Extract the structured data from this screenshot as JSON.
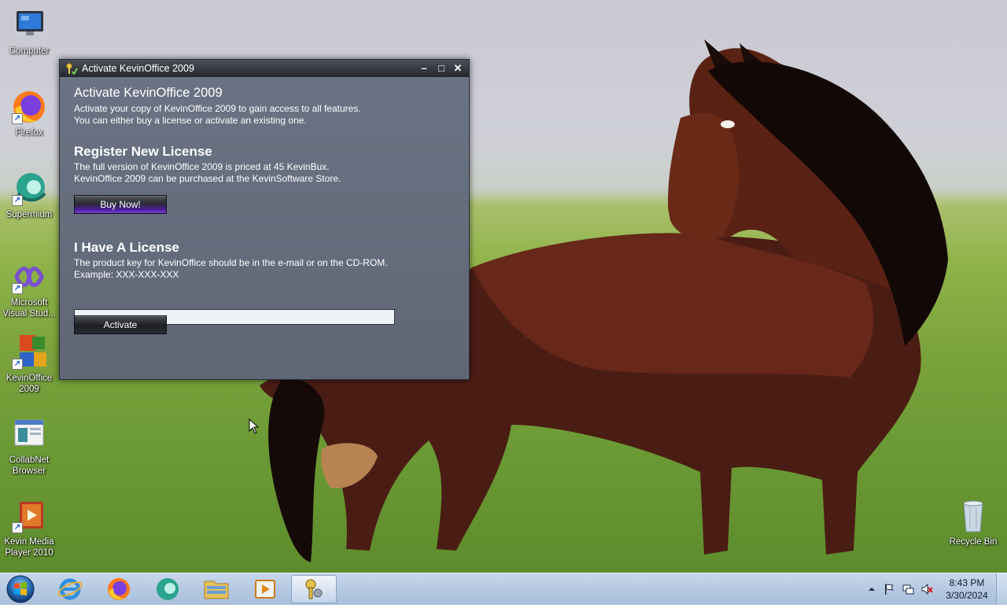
{
  "desktop": {
    "icons": [
      {
        "label": "Computer",
        "icon": "computer-icon",
        "shortcut": false
      },
      {
        "label": "Firefox",
        "icon": "firefox-icon",
        "shortcut": true
      },
      {
        "label": "Supermium",
        "icon": "supermium-icon",
        "shortcut": true
      },
      {
        "label": "Microsoft Visual Stud...",
        "icon": "visual-studio-icon",
        "shortcut": true
      },
      {
        "label": "KevinOffice 2009",
        "icon": "kevinoffice-icon",
        "shortcut": true
      },
      {
        "label": "CollabNet Browser",
        "icon": "collabnet-browser-icon",
        "shortcut": false
      },
      {
        "label": "Kevin Media Player 2010",
        "icon": "kevin-media-player-icon",
        "shortcut": true
      },
      {
        "label": "Recycle Bin",
        "icon": "recycle-bin-icon",
        "shortcut": false
      }
    ]
  },
  "dialog": {
    "title": "Activate KevinOffice 2009",
    "heading": "Activate KevinOffice 2009",
    "intro_line1": "Activate your copy of KevinOffice 2009 to gain access to all features.",
    "intro_line2": "You can either buy a license or activate an existing one.",
    "register": {
      "heading": "Register New License",
      "line1": "The full version of KevinOffice 2009 is priced at 45 KevinBux.",
      "line2": "KevinOffice 2009 can be purchased at the KevinSoftware Store.",
      "button_label": "Buy Now!"
    },
    "license": {
      "heading": "I Have A License",
      "line1": "The product key for KevinOffice should be in the e-mail or on the CD-ROM.",
      "line2": "Example: XXX-XXX-XXX",
      "input_value": "",
      "button_label": "Activate"
    },
    "controls": {
      "minimize": "minimize-icon",
      "maximize": "maximize-icon",
      "close": "close-icon"
    }
  },
  "taskbar": {
    "pinned": [
      "internet-explorer-icon",
      "firefox-icon",
      "supermium-icon",
      "file-explorer-icon",
      "media-player-icon",
      "activation-keys-icon"
    ],
    "active": "activation-keys-icon",
    "tray": [
      "show-hidden-icons-icon",
      "action-center-flag-icon",
      "network-icon",
      "volume-muted-icon"
    ],
    "clock": {
      "time": "8:43 PM",
      "date": "3/30/2024"
    }
  },
  "colors": {
    "dialog_body": "#6a7281",
    "titlebar": "#25282e",
    "buy_button_accent": "#7a3fd8",
    "taskbar": "#b5c9e2"
  }
}
